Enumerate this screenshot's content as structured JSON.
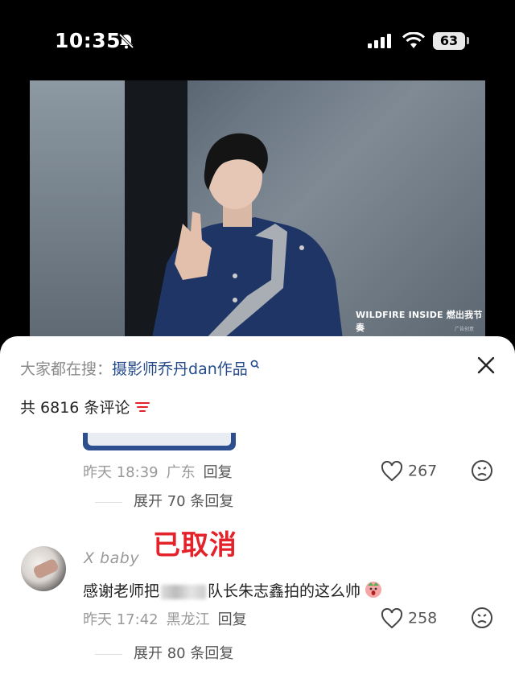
{
  "status_bar": {
    "time": "10:35",
    "battery": "63"
  },
  "video": {
    "caption": "WILDFIRE INSIDE 燃出我节奏",
    "sub": "广告创意"
  },
  "panel": {
    "search_prefix": "大家都在搜：",
    "search_term": "摄影师乔丹dan作品",
    "comment_count": "共 6816 条评论"
  },
  "comments": [
    {
      "time": "昨天 18:39",
      "location": "广东",
      "reply_label": "回复",
      "likes": "267",
      "expand": "展开 70 条回复"
    },
    {
      "username": "X baby",
      "text_before": "感谢老师把",
      "text_after": "队长朱志鑫拍的这么帅",
      "time": "昨天 17:42",
      "location": "黑龙江",
      "reply_label": "回复",
      "likes": "258",
      "expand": "展开 80 条回复"
    }
  ],
  "overlay": {
    "text": "已取消"
  },
  "colors": {
    "accent_red": "#e4222a",
    "link_blue": "#244a8a",
    "panel_bg": "#ffffff"
  }
}
